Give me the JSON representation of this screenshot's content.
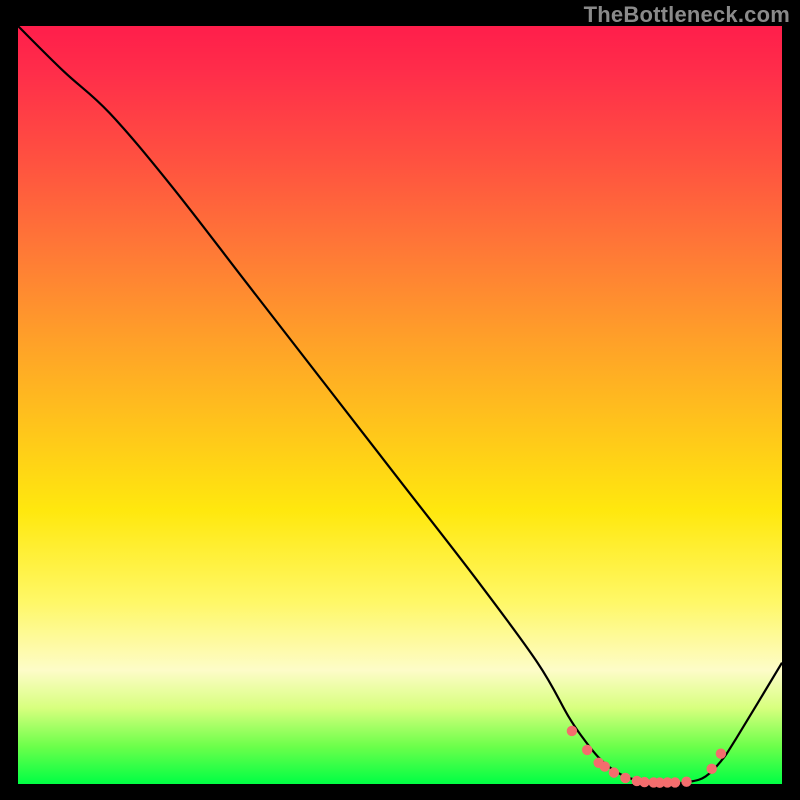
{
  "watermark": "TheBottleneck.com",
  "chart_data": {
    "type": "line",
    "title": "",
    "xlabel": "",
    "ylabel": "",
    "xlim": [
      0,
      100
    ],
    "ylim": [
      0,
      100
    ],
    "series": [
      {
        "name": "curve",
        "x": [
          0,
          6,
          12,
          20,
          30,
          40,
          50,
          60,
          68,
          72,
          74,
          76,
          78,
          80,
          82,
          84,
          86,
          88,
          90,
          92,
          94,
          100
        ],
        "y": [
          100,
          94,
          88.5,
          79,
          66,
          53,
          40,
          27,
          16,
          9,
          6,
          3.5,
          1.8,
          0.8,
          0.3,
          0.1,
          0.1,
          0.3,
          1,
          3,
          6,
          16
        ]
      }
    ],
    "markers": {
      "name": "dots",
      "color": "#f36d6d",
      "x": [
        72.5,
        74.5,
        76.0,
        76.8,
        78.0,
        79.5,
        81.0,
        82.0,
        83.2,
        84.0,
        85.0,
        86.0,
        87.5,
        90.8,
        92.0
      ],
      "y": [
        7.0,
        4.5,
        2.8,
        2.3,
        1.5,
        0.8,
        0.4,
        0.25,
        0.2,
        0.18,
        0.2,
        0.2,
        0.3,
        2.0,
        4.0
      ]
    },
    "gradient_stops": [
      {
        "pos": 0,
        "color": "#ff1e4b"
      },
      {
        "pos": 6,
        "color": "#ff2d4a"
      },
      {
        "pos": 18,
        "color": "#ff5240"
      },
      {
        "pos": 30,
        "color": "#ff7a36"
      },
      {
        "pos": 42,
        "color": "#ffa228"
      },
      {
        "pos": 54,
        "color": "#ffc81a"
      },
      {
        "pos": 64,
        "color": "#ffe80e"
      },
      {
        "pos": 76,
        "color": "#fff867"
      },
      {
        "pos": 85,
        "color": "#fdfcc8"
      },
      {
        "pos": 90,
        "color": "#d7ff7e"
      },
      {
        "pos": 95,
        "color": "#6dff4b"
      },
      {
        "pos": 100,
        "color": "#00ff44"
      }
    ]
  }
}
